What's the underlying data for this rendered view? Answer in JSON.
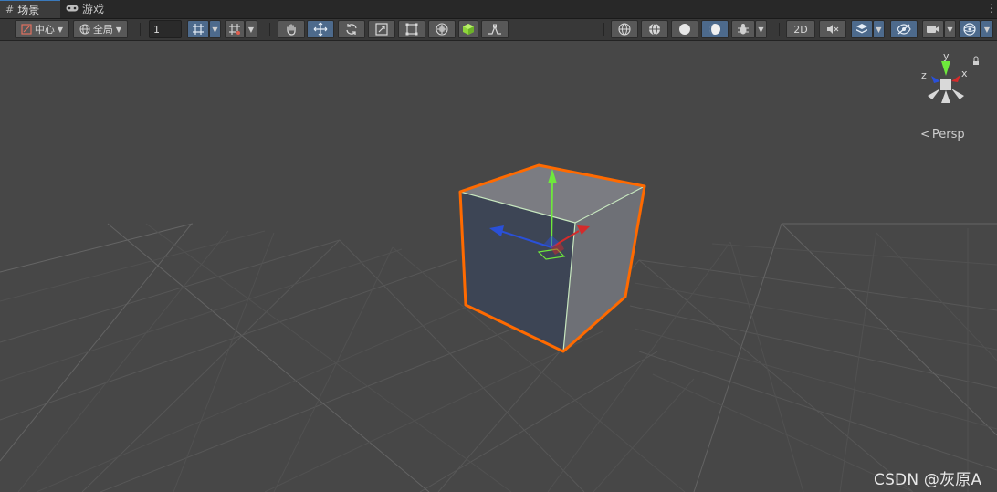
{
  "tabs": [
    {
      "label": "场景",
      "icon": "grid-icon",
      "active": true
    },
    {
      "label": "游戏",
      "icon": "gamepad-icon",
      "active": false
    }
  ],
  "toolbar": {
    "pivot_label": "中心",
    "space_label": "全局",
    "grid_increment_value": "1",
    "scene_2d_label": "2D"
  },
  "viewport": {
    "projection_label": "Persp",
    "axis_labels": {
      "y": "y",
      "x": "x",
      "z": "z"
    }
  },
  "colors": {
    "selection_outline": "#ff6a00",
    "axis_x": "#d42b2b",
    "axis_y": "#6ee83c",
    "axis_z": "#2a50d8",
    "toolbar_active": "#4d6a8c"
  },
  "watermark": "CSDN @灰原A"
}
